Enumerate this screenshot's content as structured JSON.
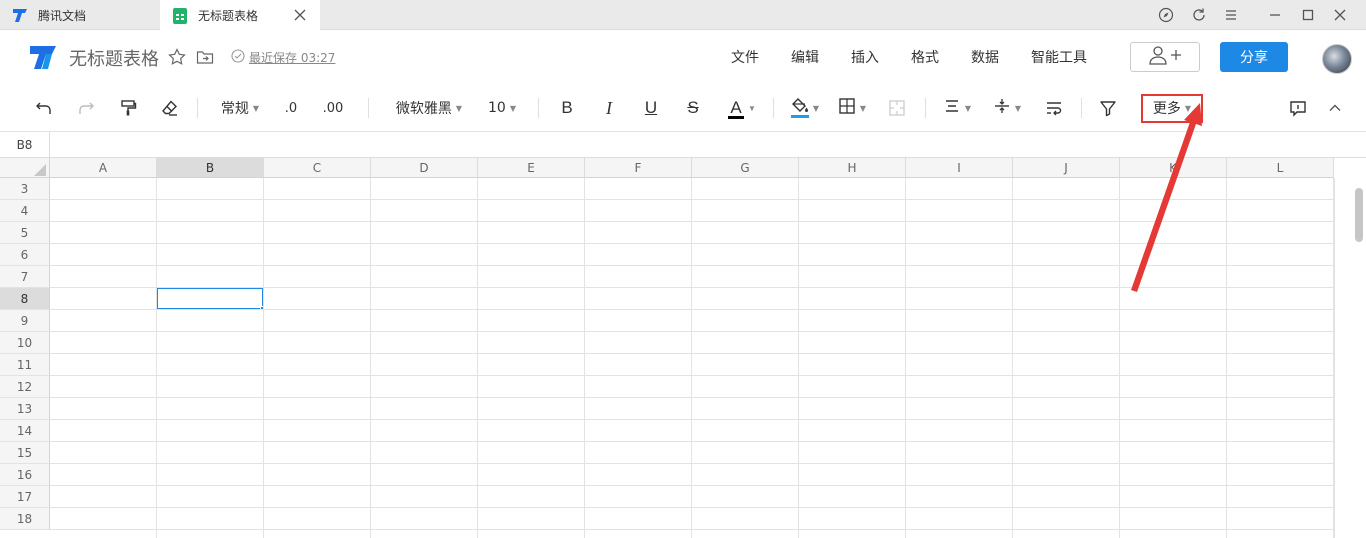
{
  "tabs": [
    {
      "label": "腾讯文档"
    },
    {
      "label": "无标题表格"
    }
  ],
  "header": {
    "title": "无标题表格",
    "saved_text": "最近保存 03:27",
    "menu": [
      "文件",
      "编辑",
      "插入",
      "格式",
      "数据",
      "智能工具"
    ],
    "share_label": "分享"
  },
  "toolbar": {
    "number_format": "常规",
    "decimal_decrease": ".0",
    "decimal_increase": ".00",
    "font_family": "微软雅黑",
    "font_size": "10",
    "bold": "B",
    "italic": "I",
    "underline": "U",
    "strike": "S",
    "text_color": "A",
    "more_label": "更多",
    "text_color_hex": "#000000",
    "fill_color_hex": "#1e9ee5"
  },
  "formula_bar": {
    "cell_ref": "B8"
  },
  "grid": {
    "columns": [
      "A",
      "B",
      "C",
      "D",
      "E",
      "F",
      "G",
      "H",
      "I",
      "J",
      "K",
      "L"
    ],
    "rows": [
      "3",
      "4",
      "5",
      "6",
      "7",
      "8",
      "9",
      "10",
      "11",
      "12",
      "13",
      "14",
      "15",
      "16",
      "17",
      "18"
    ],
    "selected_column": "B",
    "selected_row": "8"
  },
  "colors": {
    "accent": "#1e88e5",
    "highlight_box": "#e53935"
  }
}
